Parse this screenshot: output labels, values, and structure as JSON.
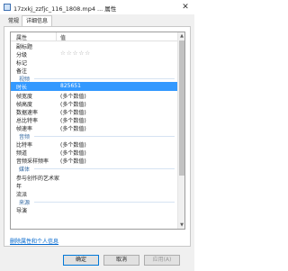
{
  "window": {
    "title": "17zxkj_zzfjc_116_1808.mp4 ... 属性",
    "close_glyph": "✕"
  },
  "tabs": [
    {
      "label": "常规"
    },
    {
      "label": "详细信息"
    }
  ],
  "columns": {
    "name": "属性",
    "value": "值"
  },
  "rows": [
    {
      "name": "副标题",
      "value": ""
    },
    {
      "name": "分级",
      "value": "☆☆☆☆☆"
    },
    {
      "name": "标记",
      "value": ""
    },
    {
      "name": "备注",
      "value": ""
    },
    {
      "name": "视频",
      "value": "",
      "section": true
    },
    {
      "name": "时长",
      "value": "825651",
      "selected": true
    },
    {
      "name": "帧宽度",
      "value": "(多个数值)"
    },
    {
      "name": "帧高度",
      "value": "(多个数值)"
    },
    {
      "name": "数据速率",
      "value": "(多个数值)"
    },
    {
      "name": "总比特率",
      "value": "(多个数值)"
    },
    {
      "name": "帧速率",
      "value": "(多个数值)"
    },
    {
      "name": "音频",
      "value": "",
      "section": true
    },
    {
      "name": "比特率",
      "value": "(多个数值)"
    },
    {
      "name": "频道",
      "value": "(多个数值)"
    },
    {
      "name": "音频采样频率",
      "value": "(多个数值)"
    },
    {
      "name": "媒体",
      "value": "",
      "section": true
    },
    {
      "name": "参与创作的艺术家",
      "value": ""
    },
    {
      "name": "年",
      "value": ""
    },
    {
      "name": "流派",
      "value": ""
    },
    {
      "name": "来源",
      "value": "",
      "section": true
    },
    {
      "name": "导演",
      "value": ""
    }
  ],
  "remove_link": "删除属性和个人信息",
  "buttons": {
    "ok": "确定",
    "cancel": "取消",
    "apply": "应用(A)"
  },
  "colors": {
    "selection": "#3399ff",
    "section_text": "#3a6ea5",
    "link": "#0066cc"
  }
}
